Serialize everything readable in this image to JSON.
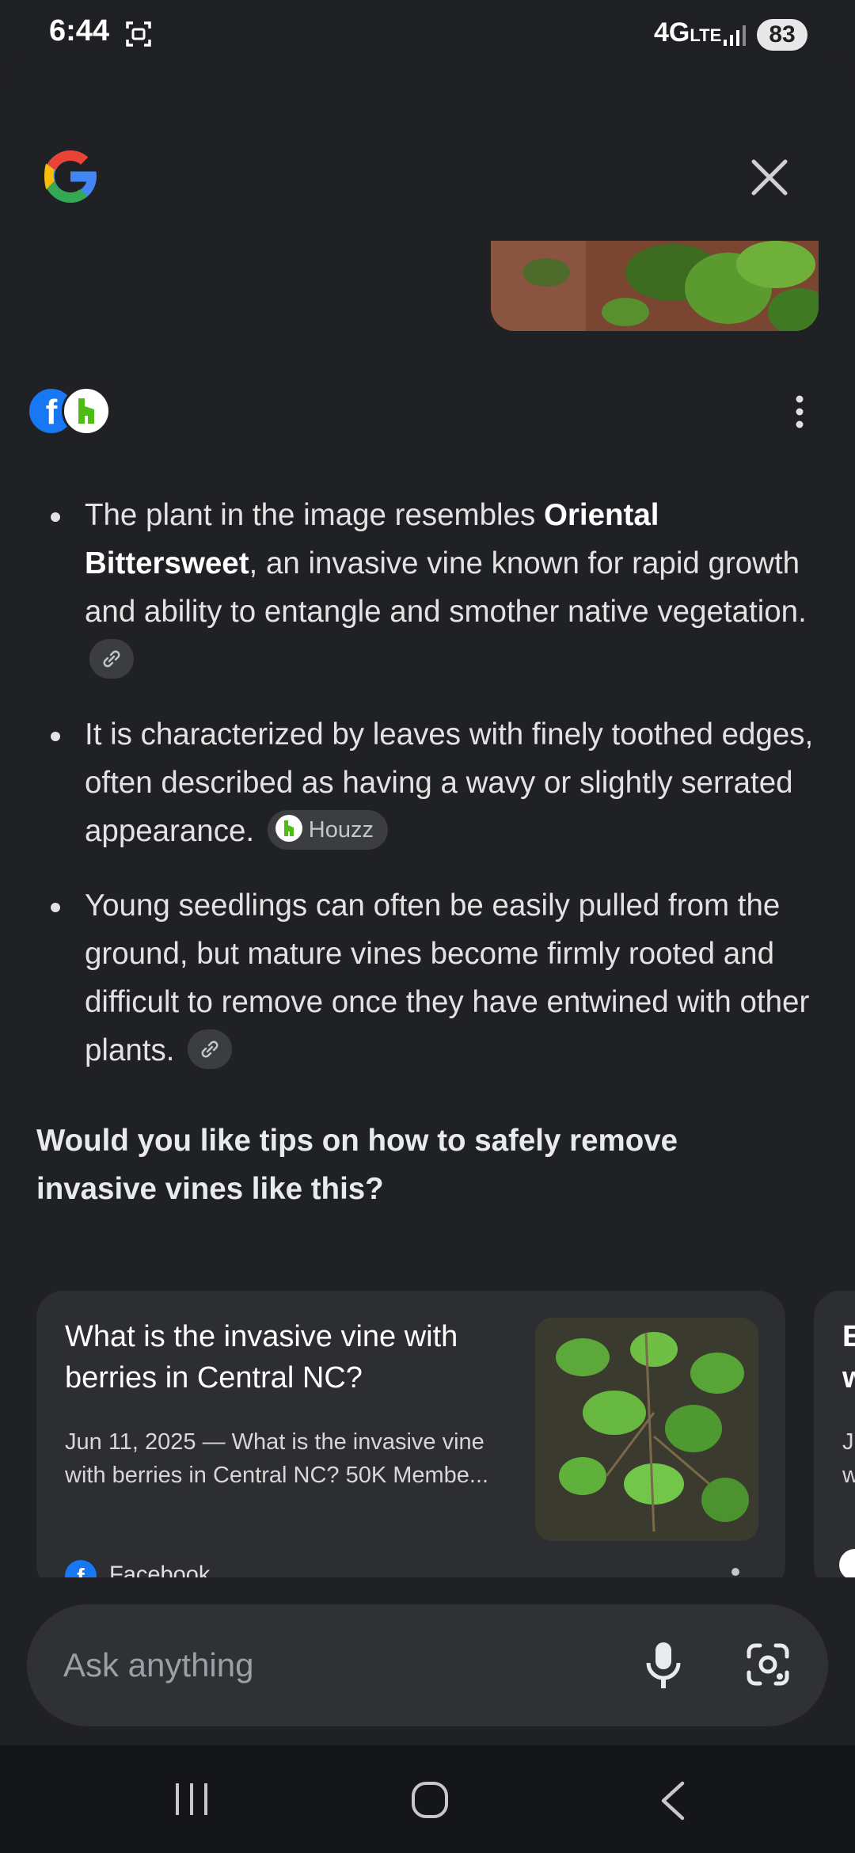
{
  "status_bar": {
    "time": "6:44",
    "network": "4G",
    "network_suffix": "LTE",
    "battery": "83"
  },
  "answer": {
    "bullets": [
      {
        "pre": "The plant in the image resembles ",
        "bold": "Oriental Bittersweet",
        "post": ", an invasive vine known for rapid growth and ability to entangle and smother native vegetation."
      },
      {
        "text": "It is characterized by leaves with finely toothed edges, often described as having a wavy or slightly serrated appearance.",
        "chip": "Houzz"
      },
      {
        "text": "Young seedlings can often be easily pulled from the ground, but mature vines become firmly rooted and difficult to remove once they have entwined with other plants."
      }
    ],
    "followup": "Would you like tips on how to safely remove invasive vines like this?"
  },
  "cards": [
    {
      "title": "What is the invasive vine with berries in Central NC?",
      "snippet": "Jun 11, 2025 — What is the invasive vine with berries in Central NC? 50K Membe...",
      "source": "Facebook"
    }
  ],
  "card2_fragment": {
    "title_a": "E",
    "title_b": "w",
    "snippet_a": "J",
    "snippet_b": "w"
  },
  "ask": {
    "placeholder": "Ask anything"
  },
  "colors": {
    "background": "#202124",
    "card": "#2d2e31",
    "askbar": "#303134",
    "facebook": "#1877f2",
    "houzz": "#4dbc15"
  }
}
